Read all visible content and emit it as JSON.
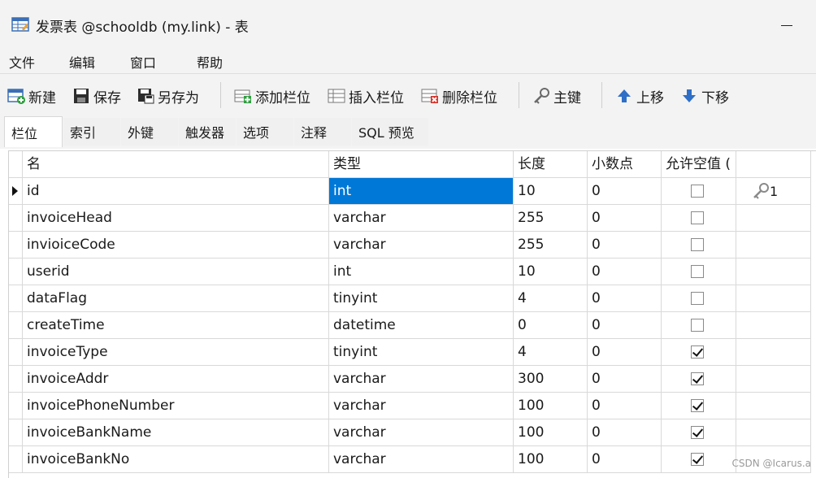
{
  "window": {
    "title": "发票表 @schooldb (my.link) - 表"
  },
  "menu": [
    "文件",
    "编辑",
    "窗口",
    "帮助"
  ],
  "toolbar": {
    "new": "新建",
    "save": "保存",
    "save_as": "另存为",
    "add_field": "添加栏位",
    "insert_field": "插入栏位",
    "delete_field": "删除栏位",
    "primary_key": "主键",
    "move_up": "上移",
    "move_down": "下移"
  },
  "tabs": [
    "栏位",
    "索引",
    "外键",
    "触发器",
    "选项",
    "注释",
    "SQL 预览"
  ],
  "grid": {
    "headers": {
      "name": "名",
      "type": "类型",
      "length": "长度",
      "decimals": "小数点",
      "nullable": "允许空值 ("
    },
    "rows": [
      {
        "name": "id",
        "type": "int",
        "length": "10",
        "decimals": "0",
        "nullable": false,
        "key": "1"
      },
      {
        "name": "invoiceHead",
        "type": "varchar",
        "length": "255",
        "decimals": "0",
        "nullable": false,
        "key": ""
      },
      {
        "name": "invioiceCode",
        "type": "varchar",
        "length": "255",
        "decimals": "0",
        "nullable": false,
        "key": ""
      },
      {
        "name": "userid",
        "type": "int",
        "length": "10",
        "decimals": "0",
        "nullable": false,
        "key": ""
      },
      {
        "name": "dataFlag",
        "type": "tinyint",
        "length": "4",
        "decimals": "0",
        "nullable": false,
        "key": ""
      },
      {
        "name": "createTime",
        "type": "datetime",
        "length": "0",
        "decimals": "0",
        "nullable": false,
        "key": ""
      },
      {
        "name": "invoiceType",
        "type": "tinyint",
        "length": "4",
        "decimals": "0",
        "nullable": true,
        "key": ""
      },
      {
        "name": "invoiceAddr",
        "type": "varchar",
        "length": "300",
        "decimals": "0",
        "nullable": true,
        "key": ""
      },
      {
        "name": "invoicePhoneNumber",
        "type": "varchar",
        "length": "100",
        "decimals": "0",
        "nullable": true,
        "key": ""
      },
      {
        "name": "invoiceBankName",
        "type": "varchar",
        "length": "100",
        "decimals": "0",
        "nullable": true,
        "key": ""
      },
      {
        "name": "invoiceBankNo",
        "type": "varchar",
        "length": "100",
        "decimals": "0",
        "nullable": true,
        "key": ""
      }
    ]
  },
  "watermark": "CSDN @Icarus.a",
  "colors": {
    "selection": "#0078d7"
  }
}
